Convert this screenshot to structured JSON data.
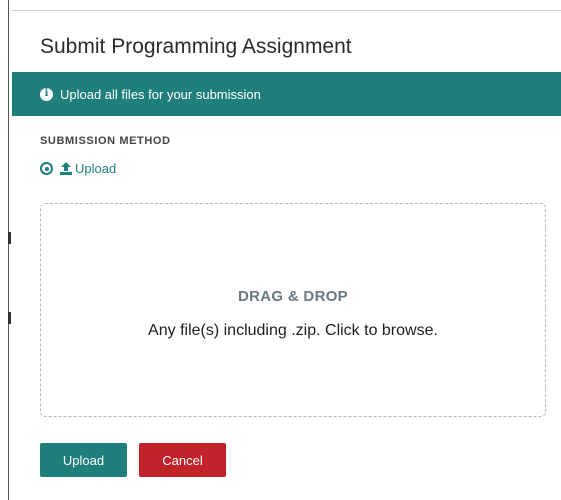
{
  "modal": {
    "title": "Submit Programming Assignment",
    "banner": {
      "icon": "info-icon",
      "text": "Upload all files for your submission"
    },
    "submission_method": {
      "heading": "SUBMISSION METHOD",
      "selected": "Upload",
      "icon": "upload-icon"
    },
    "dropzone": {
      "title": "DRAG & DROP",
      "subtitle": "Any file(s) including .zip. Click to browse."
    },
    "buttons": {
      "upload": "Upload",
      "cancel": "Cancel"
    }
  },
  "colors": {
    "accent": "#1f7f7a",
    "danger": "#c0232a",
    "muted_heading": "#6b7880"
  }
}
